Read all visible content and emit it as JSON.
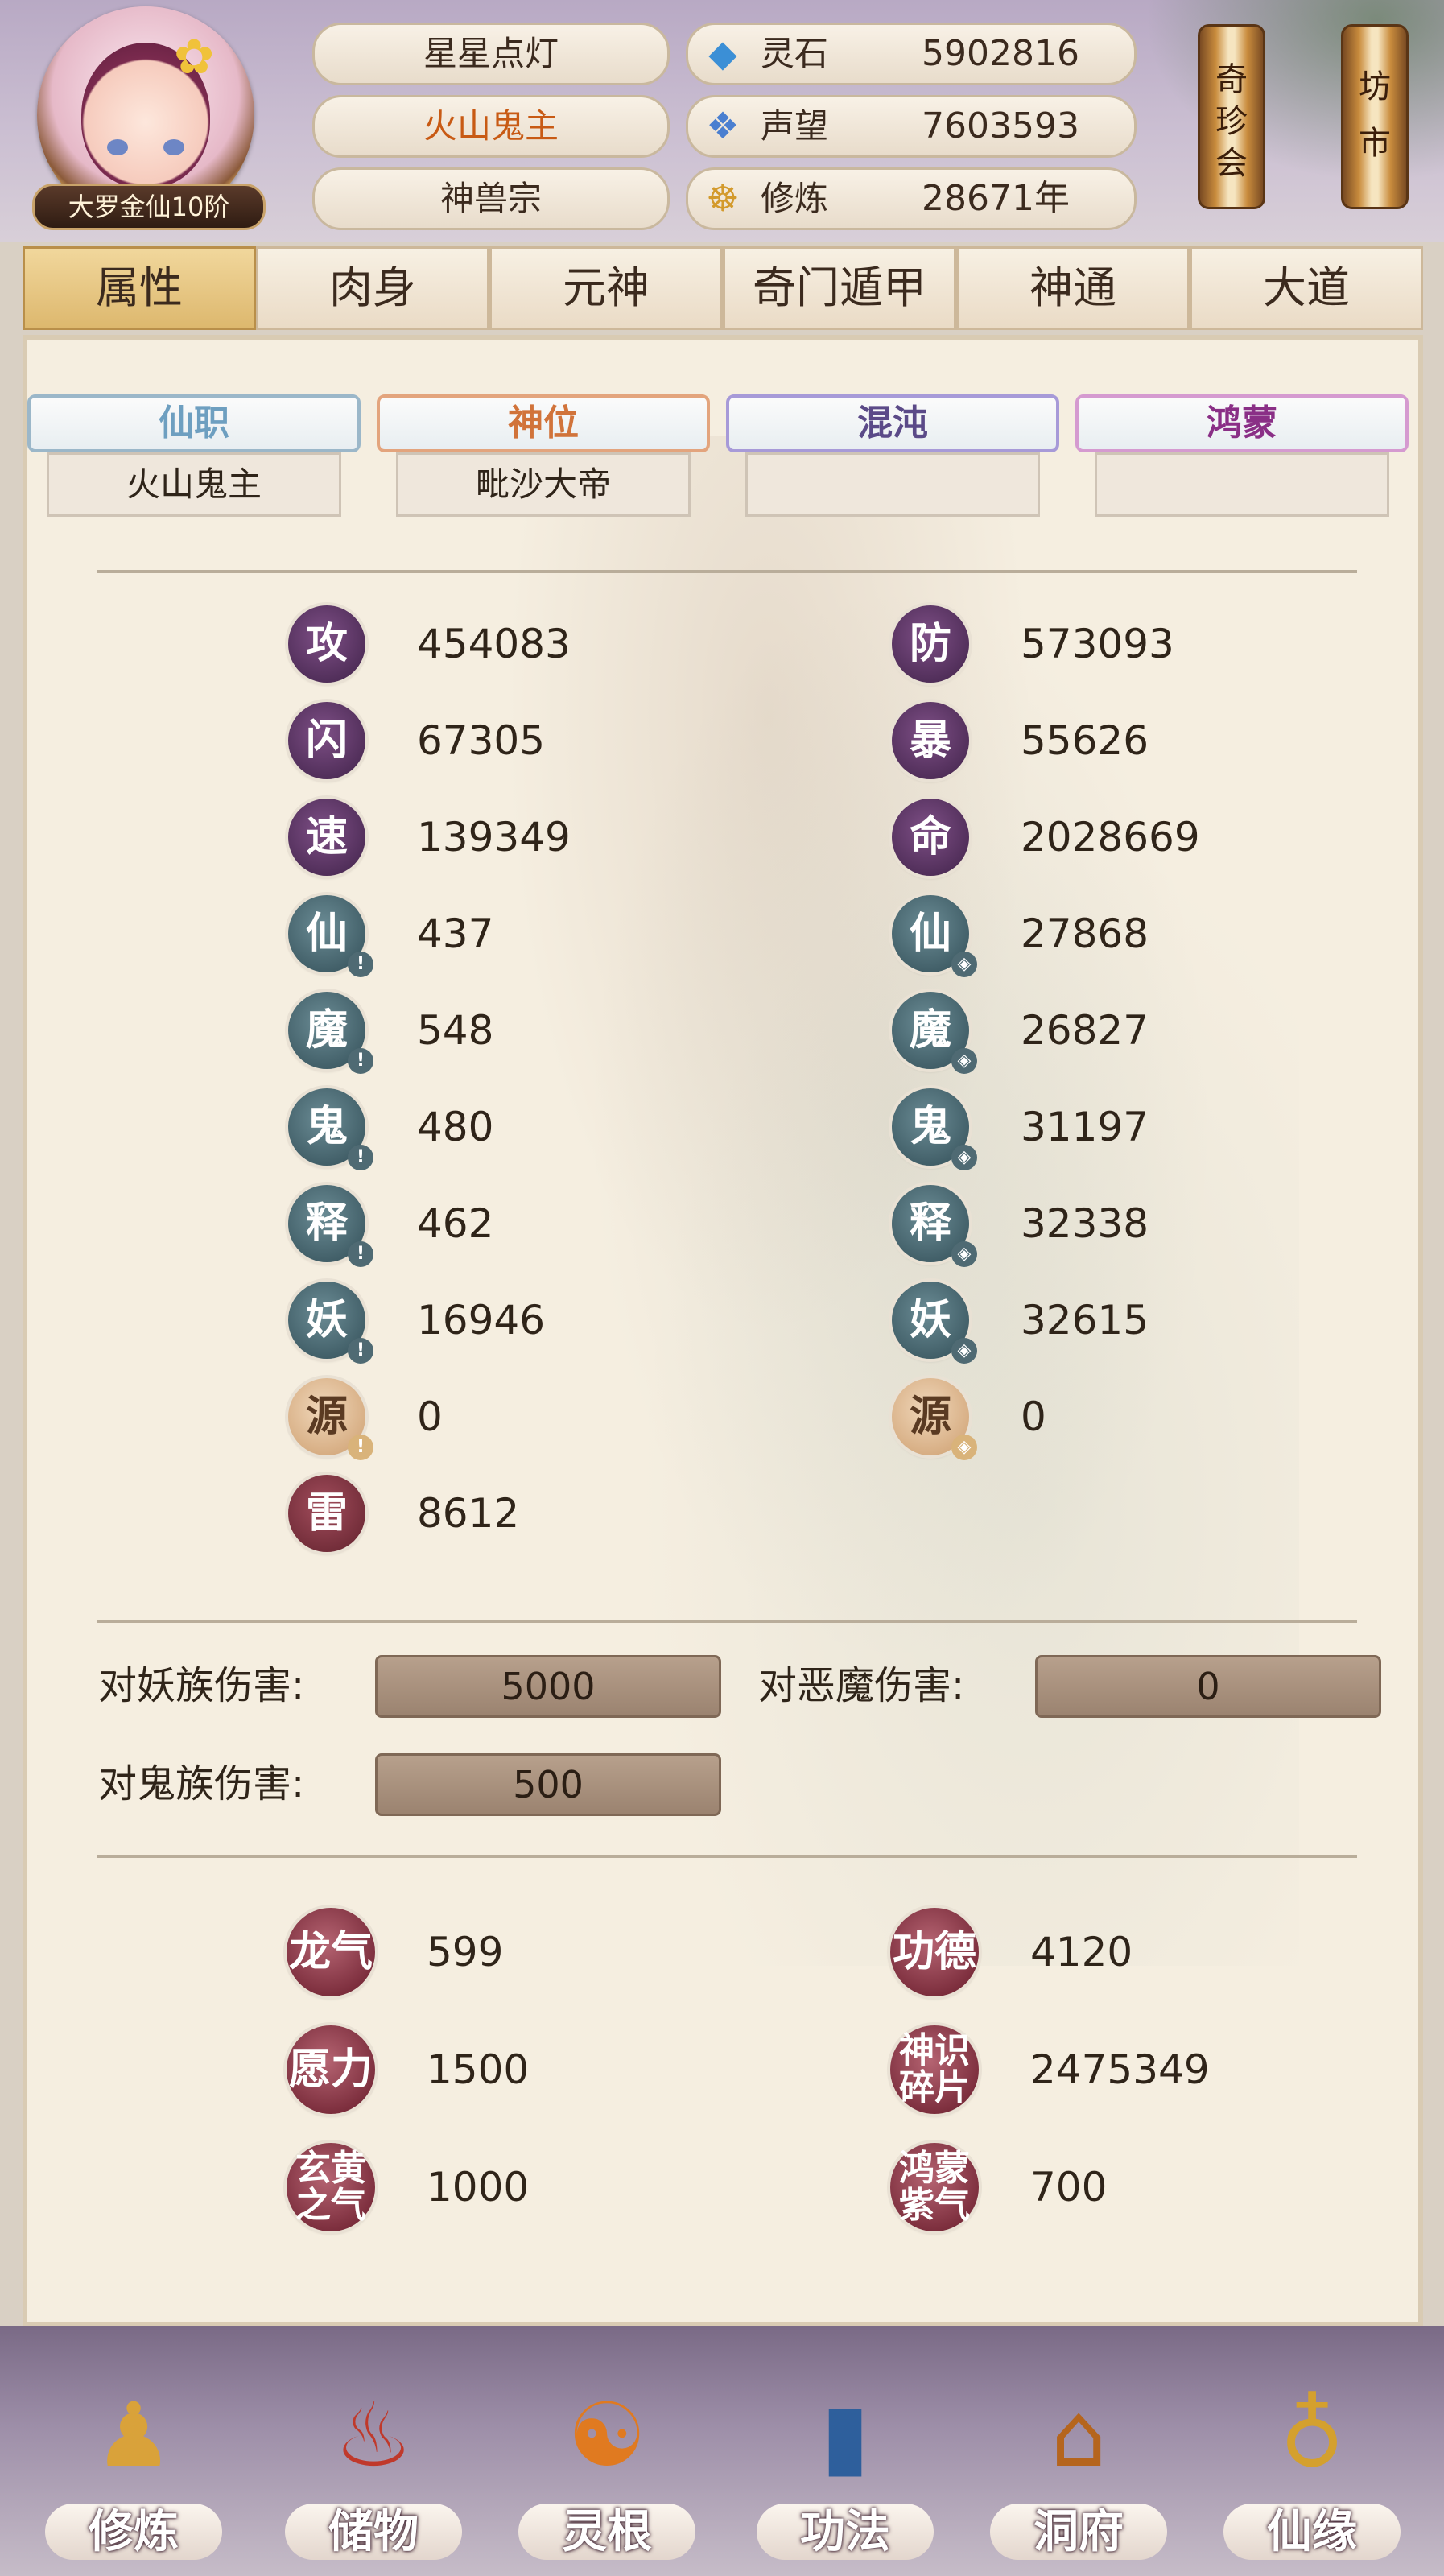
{
  "player": {
    "name": "星星点灯",
    "title": "火山鬼主",
    "sect": "神兽宗",
    "rank": "大罗金仙10阶"
  },
  "resources": [
    {
      "icon": "spirit-stone-icon",
      "label": "灵石",
      "value": "5902816"
    },
    {
      "icon": "prestige-crystal-icon",
      "label": "声望",
      "value": "7603593"
    },
    {
      "icon": "meditation-figure-icon",
      "label": "修炼",
      "value": "28671年"
    }
  ],
  "side_buttons": {
    "treasure_club": "奇珍会",
    "market": "坊市"
  },
  "tabs": [
    "属性",
    "肉身",
    "元神",
    "奇门遁甲",
    "神通",
    "大道"
  ],
  "active_tab": "属性",
  "ranks": [
    {
      "head": "仙职",
      "value": "火山鬼主",
      "head_color": "#6e9fc0",
      "border": "#9bb7c9"
    },
    {
      "head": "神位",
      "value": "毗沙大帝",
      "head_color": "#d1733a",
      "border": "#e3a47d"
    },
    {
      "head": "混沌",
      "value": "",
      "head_color": "#5b4a88",
      "border": "#a79ad8"
    },
    {
      "head": "鸿蒙",
      "value": "",
      "head_color": "#8a2f86",
      "border": "#d59ad0"
    }
  ],
  "stats_left": [
    {
      "glyph": "攻",
      "value": "454083",
      "style": "purple",
      "mark": ""
    },
    {
      "glyph": "闪",
      "value": "67305",
      "style": "purple",
      "mark": ""
    },
    {
      "glyph": "速",
      "value": "139349",
      "style": "purple",
      "mark": ""
    },
    {
      "glyph": "仙",
      "value": "437",
      "style": "teal",
      "mark": "!"
    },
    {
      "glyph": "魔",
      "value": "548",
      "style": "teal",
      "mark": "!"
    },
    {
      "glyph": "鬼",
      "value": "480",
      "style": "teal",
      "mark": "!"
    },
    {
      "glyph": "释",
      "value": "462",
      "style": "teal",
      "mark": "!"
    },
    {
      "glyph": "妖",
      "value": "16946",
      "style": "teal",
      "mark": "!"
    },
    {
      "glyph": "源",
      "value": "0",
      "style": "tan",
      "mark": "!"
    },
    {
      "glyph": "雷",
      "value": "8612",
      "style": "red",
      "mark": ""
    }
  ],
  "stats_right": [
    {
      "glyph": "防",
      "value": "573093",
      "style": "purple",
      "mark": ""
    },
    {
      "glyph": "暴",
      "value": "55626",
      "style": "purple",
      "mark": ""
    },
    {
      "glyph": "命",
      "value": "2028669",
      "style": "purple",
      "mark": ""
    },
    {
      "glyph": "仙",
      "value": "27868",
      "style": "teal",
      "mark": "◈"
    },
    {
      "glyph": "魔",
      "value": "26827",
      "style": "teal",
      "mark": "◈"
    },
    {
      "glyph": "鬼",
      "value": "31197",
      "style": "teal",
      "mark": "◈"
    },
    {
      "glyph": "释",
      "value": "32338",
      "style": "teal",
      "mark": "◈"
    },
    {
      "glyph": "妖",
      "value": "32615",
      "style": "teal",
      "mark": "◈"
    },
    {
      "glyph": "源",
      "value": "0",
      "style": "tan",
      "mark": "◈"
    }
  ],
  "damage": [
    {
      "label": "对妖族伤害:",
      "value": "5000"
    },
    {
      "label": "对恶魔伤害:",
      "value": "0"
    },
    {
      "label": "对鬼族伤害:",
      "value": "500"
    }
  ],
  "extra_resources": [
    {
      "glyph": "龙气",
      "value": "599"
    },
    {
      "glyph": "功德",
      "value": "4120"
    },
    {
      "glyph": "愿力",
      "value": "1500"
    },
    {
      "glyph": "神识碎片",
      "value": "2475349"
    },
    {
      "glyph": "玄黄之气",
      "value": "1000"
    },
    {
      "glyph": "鸿蒙紫气",
      "value": "700"
    }
  ],
  "bottom_nav": [
    {
      "label": "修炼",
      "icon": "monk-icon"
    },
    {
      "label": "储物",
      "icon": "storage-bag-icon"
    },
    {
      "label": "灵根",
      "icon": "spirit-root-icon"
    },
    {
      "label": "功法",
      "icon": "scripture-book-icon"
    },
    {
      "label": "洞府",
      "icon": "cave-palace-icon"
    },
    {
      "label": "仙缘",
      "icon": "gourd-icon"
    }
  ]
}
